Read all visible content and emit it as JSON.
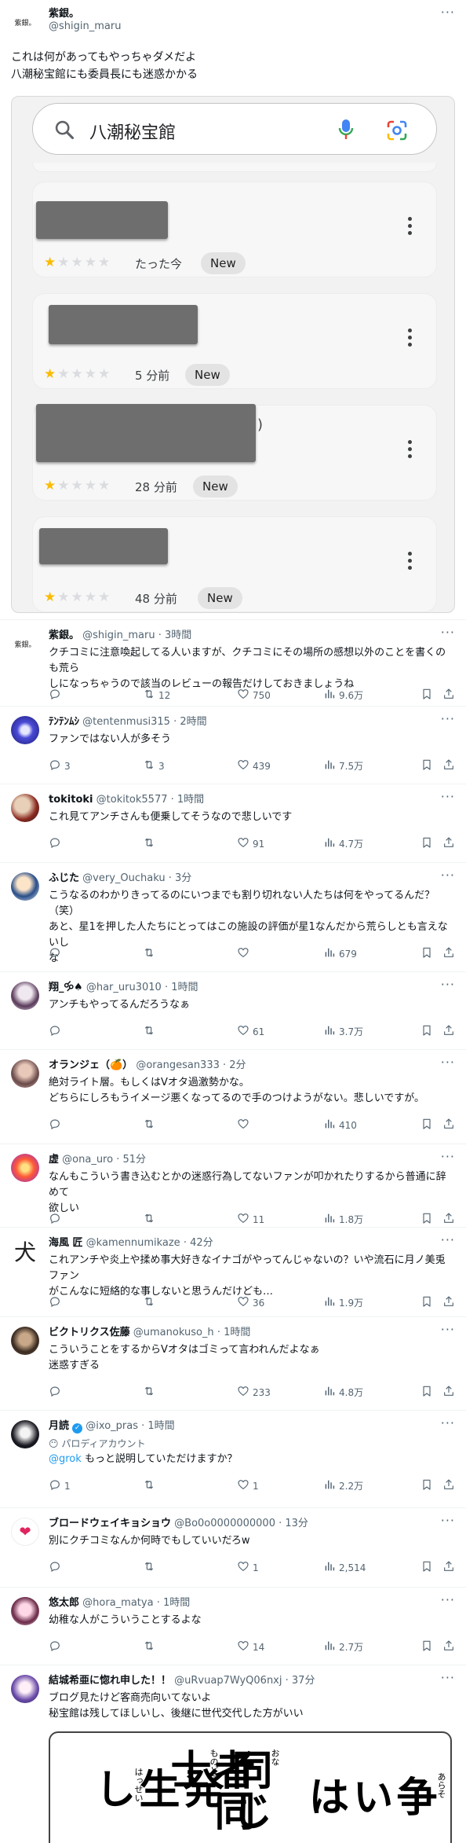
{
  "main": {
    "avatar_text": "紫銀。",
    "name": "紫銀。",
    "handle": "@shigin_maru",
    "more": "···",
    "lines": [
      "これは何があってもやっちゃダメだよ",
      "八潮秘宝館にも委員長にも迷惑かかる"
    ]
  },
  "google": {
    "query": "八潮秘宝館",
    "reviews": [
      {
        "time": "たった今",
        "badge": "New",
        "rating": 1
      },
      {
        "time": "5 分前",
        "badge": "New",
        "rating": 1
      },
      {
        "time": "28 分前",
        "badge": "New",
        "rating": 1,
        "tail": ")"
      },
      {
        "time": "48 分前",
        "badge": "New",
        "rating": 1
      }
    ]
  },
  "replies": [
    {
      "name": "紫銀。",
      "handle": "@shigin_maru",
      "time": "· 3時間",
      "lines": [
        "クチコミに注意喚起してる人いますが、クチコミにその場所の感想以外のことを書くのも荒ら",
        "しになっちゃうので該当のレビューの報告だけしておきましょうね"
      ],
      "replies": "",
      "retweets": "12",
      "likes": "750",
      "views": "9.6万"
    },
    {
      "name": "ﾃﾝﾃﾝﾑｼ",
      "handle": "@tentenmusi315",
      "time": "· 2時間",
      "lines": [
        "ファンではない人が多そう"
      ],
      "replies": "3",
      "retweets": "3",
      "likes": "439",
      "views": "7.5万"
    },
    {
      "name": "tokitoki",
      "handle": "@tokitok5577",
      "time": "· 1時間",
      "lines": [
        "これ見てアンチさんも便乗してそうなので悲しいです"
      ],
      "replies": "",
      "retweets": "",
      "likes": "91",
      "views": "4.7万"
    },
    {
      "name": "ふじた",
      "handle": "@very_Ouchaku",
      "time": "· 3分",
      "lines": [
        "こうなるのわかりきってるのにいつまでも割り切れない人たちは何をやってるんだ？（笑）",
        "あと、星1を押した人たちにとってはこの施設の評価が星1なんだから荒らしとも言えないし",
        "な"
      ],
      "replies": "",
      "retweets": "",
      "likes": "",
      "views": "679"
    },
    {
      "name": "翔_🝰♠",
      "handle": "@har_uru3010",
      "time": "· 1時間",
      "lines": [
        "アンチもやってるんだろうなぁ"
      ],
      "replies": "",
      "retweets": "",
      "likes": "61",
      "views": "3.7万"
    },
    {
      "name": "オランジェ（🍊）",
      "handle": "@orangesan333",
      "time": "· 2分",
      "lines": [
        "絶対ライト層。もしくはVオタ過激勢かな。",
        "どちらにしろもうイメージ悪くなってるので手のつけようがない。悲しいですが。"
      ],
      "replies": "",
      "retweets": "",
      "likes": "",
      "views": "410"
    },
    {
      "name": "虚",
      "handle": "@ona_uro",
      "time": "· 51分",
      "lines": [
        "なんもこういう書き込むとかの迷惑行為してないファンが叩かれたりするから普通に辞めて",
        "欲しい"
      ],
      "replies": "",
      "retweets": "",
      "likes": "11",
      "views": "1.8万"
    },
    {
      "name": "海風 匠",
      "handle": "@kamennumikaze",
      "time": "· 42分",
      "avatar_text": "犬",
      "lines": [
        "これアンチや炎上や揉め事大好きなイナゴがやってんじゃないの？いや流石に月ノ美兎ファン",
        "がこんなに短絡的な事しないと思うんだけども…"
      ],
      "replies": "",
      "retweets": "",
      "likes": "36",
      "views": "1.9万"
    },
    {
      "name": "ビクトリクス佐藤",
      "handle": "@umanokuso_h",
      "time": "· 1時間",
      "lines": [
        "こういうことをするからVオタはゴミって言われんだよなぁ",
        "迷惑すぎる"
      ],
      "replies": "",
      "retweets": "",
      "likes": "233",
      "views": "4.8万"
    },
    {
      "name": "月読",
      "handle": "@ixo_pras",
      "time": "· 1時間",
      "parody": "パロディアカウント",
      "mention": "@grok",
      "lines": [
        "もっと説明していただけますか？"
      ],
      "replies": "1",
      "retweets": "",
      "likes": "1",
      "views": "2.2万"
    },
    {
      "name": "ブロードウェイキョショウ",
      "handle": "@Bo0o0000000000",
      "time": "· 13分",
      "lines": [
        "別にクチコミなんか何時でもしていいだろw"
      ],
      "replies": "",
      "retweets": "",
      "likes": "1",
      "views": "2,514"
    },
    {
      "name": "悠太郎",
      "handle": "@hora_matya",
      "time": "· 1時間",
      "lines": [
        "幼稚な人がこういうことするよな"
      ],
      "replies": "",
      "retweets": "",
      "likes": "14",
      "views": "2.7万"
    },
    {
      "name": "結城希亜に惚れ申した！！",
      "handle": "@uRvuap7WyQ06nxj",
      "time": "· 37分",
      "lines": [
        "ブログ見たけど客商売向いてないよ",
        "秘宝館は残してほしいし、後継に世代交代した方がいい"
      ]
    }
  ],
  "manga": {
    "col1": "同じ",
    "col2": "者同士",
    "col3": "発生し",
    "col4": "争いは",
    "ruby1": "おな",
    "ruby2": "ものどう",
    "ruby3": "はっせい",
    "ruby4": "あらそ"
  }
}
